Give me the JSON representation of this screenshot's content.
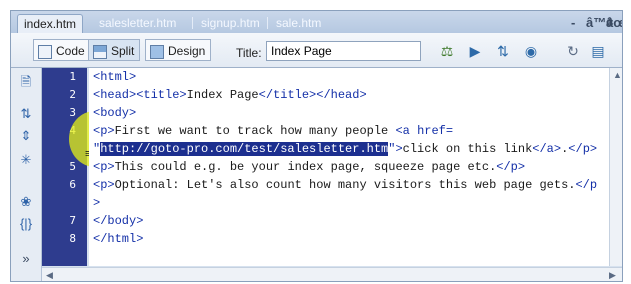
{
  "tabs": [
    {
      "label": "index.htm",
      "active": true
    },
    {
      "label": "salesletter.htm",
      "active": false
    },
    {
      "label": "signup.htm",
      "active": false
    },
    {
      "label": "sale.htm",
      "active": false
    }
  ],
  "window_controls": {
    "minimize": "-",
    "restore": "â™¢",
    "close": "âœ•"
  },
  "toolbar": {
    "code_label": "Code",
    "split_label": "Split",
    "design_label": "Design",
    "title_label": "Title:",
    "title_value": "Index Page"
  },
  "line_numbers": [
    "1",
    "2",
    "3",
    "4",
    "5",
    "6",
    "7",
    "8"
  ],
  "code_lines": [
    {
      "tag1": "<html>"
    },
    {
      "tag1": "<head><title>",
      "text": "Index Page",
      "tag2": "</title></head>"
    },
    {
      "tag1": "<body>"
    },
    {
      "tag1": "<p>",
      "text": "First we want to track how many people ",
      "tag2": "<a href="
    },
    {
      "quote": "\"",
      "selected": "http://goto-pro.com/test/salesletter.htm",
      "tag1": "\">",
      "text": "click on this link",
      "tag2": "</a>",
      "text2": ".",
      "tag3": "</p>"
    },
    {
      "tag1": "<p>",
      "text": "This could e.g. be your index page, squeeze page etc.",
      "tag2": "</p>"
    },
    {
      "tag1": "<p>",
      "text": "Optional: Let's also count how many visitors this web page gets.",
      "tag2": "</p"
    },
    {
      "tag1": ">"
    },
    {
      "tag1": "</body>"
    },
    {
      "tag1": "</html>"
    }
  ],
  "colors": {
    "line_number_bg": "#2e3c8e",
    "tag": "#1430a8",
    "selection": "#1c2f8f",
    "highlight": "#e6f014"
  }
}
